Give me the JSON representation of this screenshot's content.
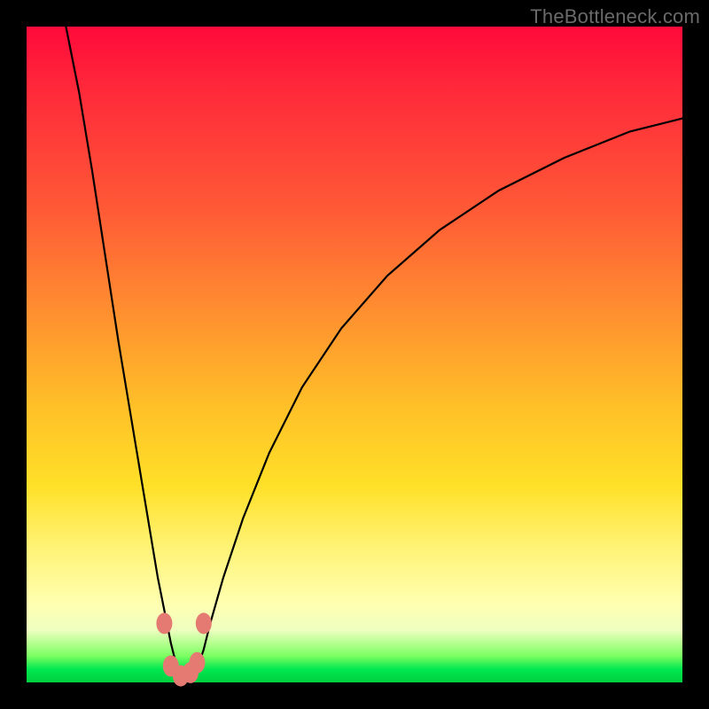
{
  "watermark": "TheBottleneck.com",
  "chart_data": {
    "type": "line",
    "title": "",
    "xlabel": "",
    "ylabel": "",
    "xlim": [
      0,
      100
    ],
    "ylim": [
      0,
      100
    ],
    "note": "No axis ticks or numeric labels are rendered in the original image; x/y are normalized 0–100 across the plot area. Curve is a V-shaped profile with minimum near x≈24, y≈0; values are visual estimates.",
    "series": [
      {
        "name": "curve",
        "x": [
          6,
          8,
          10,
          12,
          14,
          16,
          18,
          20,
          21,
          22,
          23,
          24,
          25,
          26,
          27,
          28,
          30,
          33,
          37,
          42,
          48,
          55,
          63,
          72,
          82,
          92,
          100
        ],
        "y": [
          100,
          90,
          78,
          65,
          52,
          40,
          28,
          16,
          11,
          6,
          2,
          0.5,
          0.5,
          2,
          5,
          9,
          16,
          25,
          35,
          45,
          54,
          62,
          69,
          75,
          80,
          84,
          86
        ]
      }
    ],
    "markers": [
      {
        "x": 21.0,
        "y": 9.0
      },
      {
        "x": 27.0,
        "y": 9.0
      },
      {
        "x": 22.0,
        "y": 2.5
      },
      {
        "x": 23.5,
        "y": 1.0
      },
      {
        "x": 25.0,
        "y": 1.5
      },
      {
        "x": 26.0,
        "y": 3.0
      }
    ],
    "gradient_stops": [
      {
        "pct": 0,
        "color": "#ff0a3a"
      },
      {
        "pct": 28,
        "color": "#ff5a36"
      },
      {
        "pct": 58,
        "color": "#ffc028"
      },
      {
        "pct": 88,
        "color": "#ffffb0"
      },
      {
        "pct": 96,
        "color": "#7aff60"
      },
      {
        "pct": 100,
        "color": "#00d040"
      }
    ]
  }
}
